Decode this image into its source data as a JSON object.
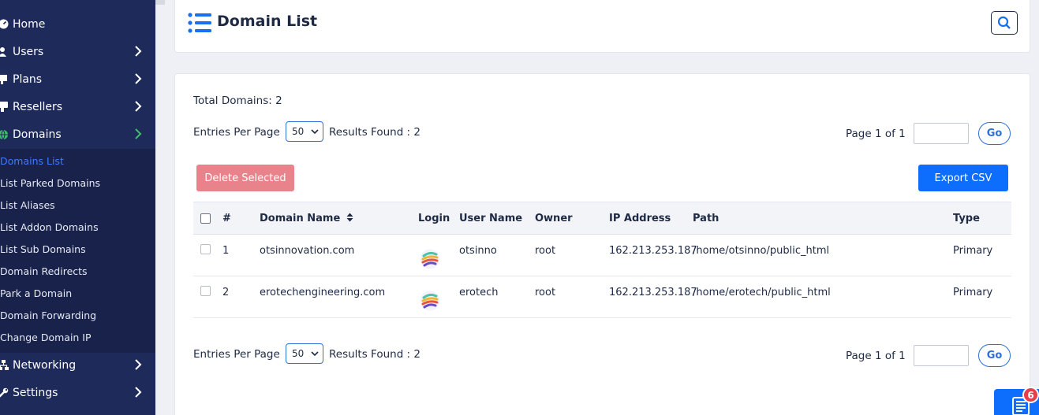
{
  "sidebar": {
    "items": [
      {
        "label": "Home",
        "icon": "speedometer-icon"
      },
      {
        "label": "Users",
        "icon": "user-icon"
      },
      {
        "label": "Plans",
        "icon": "plans-icon"
      },
      {
        "label": "Resellers",
        "icon": "reseller-icon"
      },
      {
        "label": "Domains",
        "icon": "globe-icon"
      },
      {
        "label": "Networking",
        "icon": "network-icon"
      },
      {
        "label": "Settings",
        "icon": "wrench-icon"
      }
    ],
    "domains_submenu": [
      "Domains List",
      "List Parked Domains",
      "List Aliases",
      "List Addon Domains",
      "List Sub Domains",
      "Domain Redirects",
      "Park a Domain",
      "Domain Forwarding",
      "Change Domain IP"
    ]
  },
  "header": {
    "title": "Domain List"
  },
  "summary": {
    "total_domains": "Total Domains: 2"
  },
  "pagination_top": {
    "entries_label": "Entries Per Page",
    "entries_value": "50",
    "results_found": "Results Found : 2",
    "page_info": "Page 1 of 1",
    "go_label": "Go"
  },
  "pagination_bottom": {
    "entries_label": "Entries Per Page",
    "entries_value": "50",
    "results_found": "Results Found : 2",
    "page_info": "Page 1 of 1",
    "go_label": "Go"
  },
  "actions": {
    "delete_label": "Delete Selected",
    "export_label": "Export CSV"
  },
  "table": {
    "columns": [
      "#",
      "Domain Name",
      "Login",
      "User Name",
      "Owner",
      "IP Address",
      "Path",
      "Type"
    ],
    "rows": [
      {
        "num": "1",
        "domain": "otsinnovation.com",
        "user": "otsinno",
        "owner": "root",
        "ip": "162.213.253.187",
        "path": "/home/otsinno/public_html",
        "type": "Primary"
      },
      {
        "num": "2",
        "domain": "erotechengineering.com",
        "user": "erotech",
        "owner": "root",
        "ip": "162.213.253.187",
        "path": "/home/erotech/public_html",
        "type": "Primary"
      }
    ]
  },
  "widget": {
    "badge_count": "6"
  },
  "colors": {
    "sidebar": "#1e2a5a",
    "accent": "#0d6efd",
    "active_link": "#3d7bff",
    "danger": "#e8838b",
    "domains_chevron": "#3fbf6a"
  }
}
